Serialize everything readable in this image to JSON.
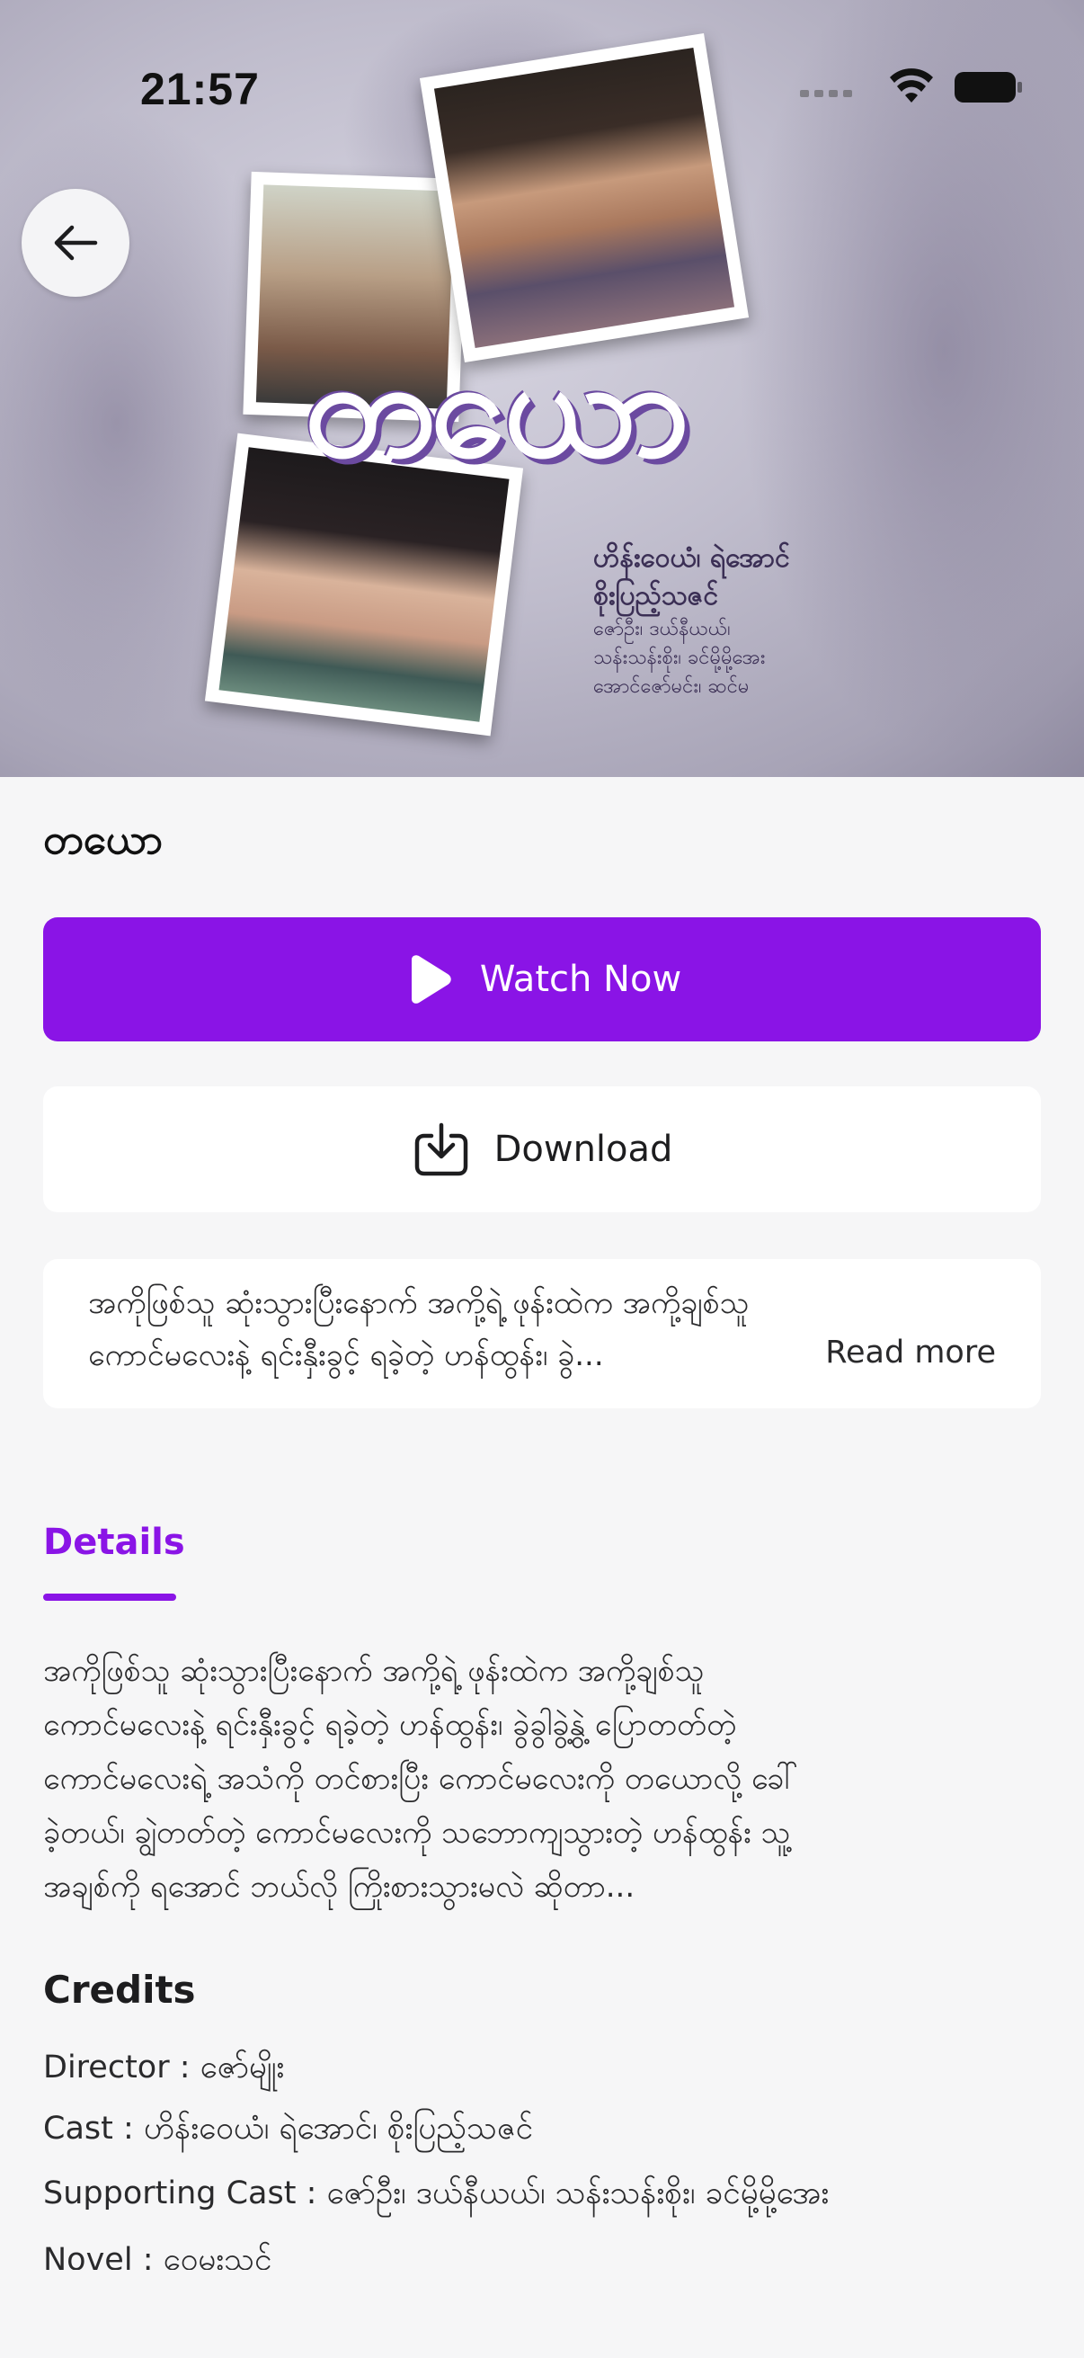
{
  "status_bar": {
    "time": "21:57"
  },
  "poster": {
    "title_art": "တယော",
    "cast_lines_big": [
      "ဟိန်းဝေယံ၊ ရဲအောင်",
      "စိုးပြည့်သဇင်"
    ],
    "cast_lines_small": [
      "ဇော်ဦး၊ ဒယ်နီယယ်၊",
      "သန်းသန်းစိုး၊ ခင်မို့မို့အေး",
      "အောင်ဇော်မင်း၊ ဆင်မ"
    ]
  },
  "movie": {
    "title": "တယော"
  },
  "actions": {
    "watch_label": "Watch Now",
    "download_label": "Download"
  },
  "synopsis": {
    "line1": "အကိုဖြစ်သူ ဆုံးသွားပြီးနောက် အကို့ရဲ့ ဖုန်းထဲက အကို့ချစ်သူ",
    "line2": "ကောင်မလေးနဲ့ ရင်းနှီးခွင့် ရခဲ့တဲ့  ဟန်ထွန်း၊ ခွဲ...",
    "read_more": "Read more"
  },
  "tabs": {
    "details": "Details"
  },
  "details": {
    "lines": [
      "အကိုဖြစ်သူ ဆုံးသွားပြီးနောက် အကို့ရဲ့ ဖုန်းထဲက အကို့ချစ်သူ",
      "ကောင်မလေးနဲ့ ရင်းနှီးခွင့် ရခဲ့တဲ့ ဟန်ထွန်း၊ ခွဲခွါခွဲ့နွဲ့ ပြောတတ်တဲ့",
      "ကောင်မလေးရဲ့ အသံကို တင်စားပြီး ကောင်မလေးကို တယောလို့ ခေါ်",
      "ခဲ့တယ်၊ ချွဲတတ်တဲ့ ကောင်မလေးကို သဘောကျသွားတဲ့ ဟန်ထွန်း သူ့",
      "အချစ်ကို ရအောင် ဘယ်လို ကြိုးစားသွားမလဲ ဆိုတာ..."
    ]
  },
  "credits": {
    "heading": "Credits",
    "director": "Director : ဇော်မျိုး",
    "cast": "Cast : ဟိန်းဝေယံ၊ ရဲအောင်၊ စိုးပြည့်သဇင်",
    "supporting": "Supporting Cast : ဇော်ဦး၊ ဒယ်နီယယ်၊ သန်းသန်းစိုး၊ ခင်မို့မို့အေး",
    "novel": "Novel : ဝေမးသင်"
  },
  "colors": {
    "accent": "#8a14e6",
    "background": "#f6f6f7"
  },
  "icons": {
    "back": "arrow-left-icon",
    "play": "play-icon",
    "download": "download-icon"
  }
}
